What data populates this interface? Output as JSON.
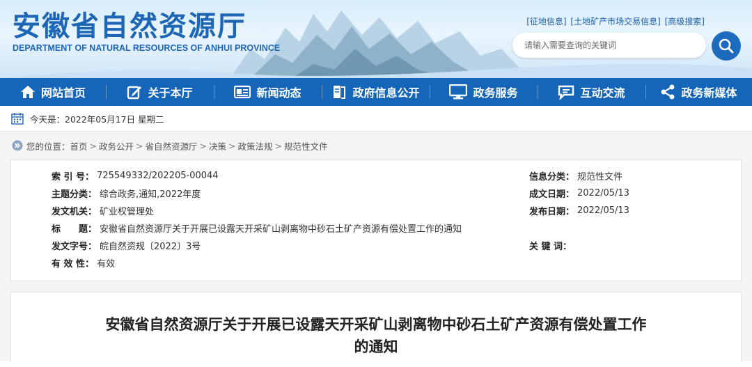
{
  "site": {
    "title_cn": "安徽省自然资源厅",
    "title_en": "DEPARTMENT OF NATURAL RESOURCES OF ANHUI PROVINCE",
    "top_links": [
      "[征地信息]",
      "[土地矿产市场交易信息]",
      "[高级搜索]"
    ],
    "search_placeholder": "请输入需要查询的关键词",
    "search_icon": "search-icon"
  },
  "nav": [
    {
      "label": "网站首页",
      "icon": "home-icon"
    },
    {
      "label": "关于本厅",
      "icon": "edit-icon"
    },
    {
      "label": "新闻动态",
      "icon": "news-icon"
    },
    {
      "label": "政府信息公开",
      "icon": "document-icon"
    },
    {
      "label": "政务服务",
      "icon": "monitor-icon"
    },
    {
      "label": "互动交流",
      "icon": "chat-icon"
    },
    {
      "label": "政务新媒体",
      "icon": "share-icon"
    }
  ],
  "date_bar": {
    "text": "今天是：2022年05月17日 星期二",
    "icon": "calendar-icon"
  },
  "breadcrumb": {
    "prefix": "您的位置：",
    "icon": "double-chevron-icon",
    "items": [
      "首页",
      "政务公开",
      "省自然资源厅",
      "决策",
      "政策法规",
      "规范性文件"
    ]
  },
  "meta": {
    "index_label": "索 引 号：",
    "index_value": "725549332/202205-00044",
    "category_label": "信息分类：",
    "category_value": "规范性文件",
    "topic_label": "主题分类：",
    "topic_value": "综合政务,通知,2022年度",
    "created_label": "成文日期：",
    "created_value": "2022/05/13",
    "issuer_label": "发文机关：",
    "issuer_value": "矿业权管理处",
    "published_label": "发布日期：",
    "published_value": "2022/05/13",
    "title_label": "标　　题：",
    "title_value": "安徽省自然资源厅关于开展已设露天开采矿山剥离物中砂石土矿产资源有偿处置工作的通知",
    "docno_label": "发文字号：",
    "docno_value": "皖自然资规〔2022〕3号",
    "keywords_label": "关 键 词：",
    "keywords_value": "",
    "validity_label": "有 效 性：",
    "validity_value": "有效"
  },
  "article": {
    "title_line1": "安徽省自然资源厅关于开展已设露天开采矿山剥离物中砂石土矿产资源有偿处置工作",
    "title_line2": "的通知"
  },
  "colors": {
    "brand_blue": "#1d66b6",
    "nav_blue": "#1566b8"
  }
}
